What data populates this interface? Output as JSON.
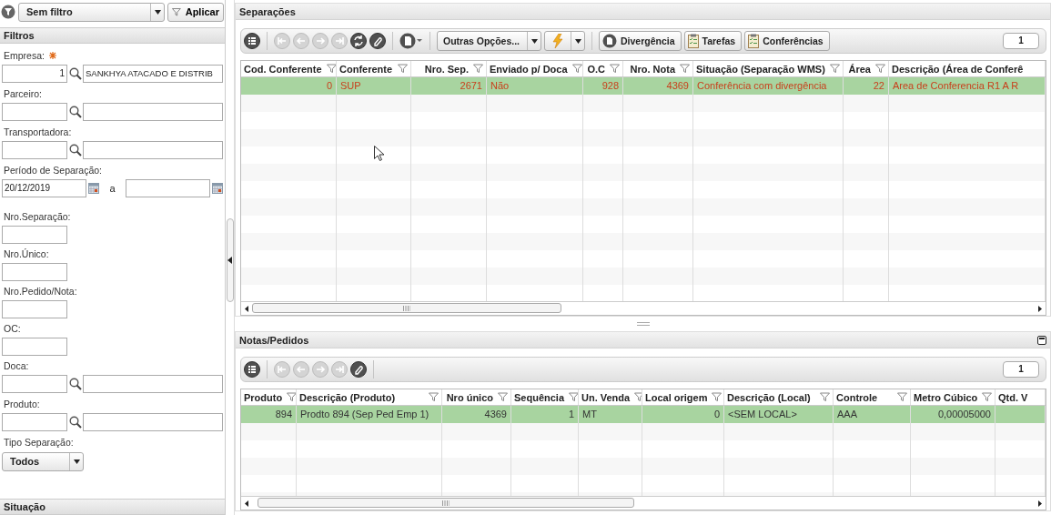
{
  "filter_bar": {
    "preset": "Sem filtro",
    "apply": "Aplicar"
  },
  "filters": {
    "title": "Filtros",
    "fields": [
      {
        "kind": "lookup",
        "label": "Empresa:",
        "required": true,
        "code": "1",
        "description": "SANKHYA ATACADO E DISTRIB"
      },
      {
        "kind": "lookup",
        "label": "Parceiro:",
        "required": false
      },
      {
        "kind": "lookup",
        "label": "Transportadora:",
        "required": false
      },
      {
        "kind": "date-range",
        "label": "Período de Separação:",
        "required": false,
        "from": "20/12/2019",
        "separator": "a"
      },
      {
        "kind": "text",
        "label": "Nro.Separação:",
        "required": false
      },
      {
        "kind": "text",
        "label": "Nro.Único:",
        "required": false
      },
      {
        "kind": "text",
        "label": "Nro.Pedido/Nota:",
        "required": false
      },
      {
        "kind": "text",
        "label": "OC:",
        "required": false
      },
      {
        "kind": "lookup",
        "label": "Doca:",
        "required": false
      },
      {
        "kind": "lookup",
        "label": "Produto:",
        "required": false
      },
      {
        "kind": "select",
        "label": "Tipo Separação:",
        "required": false,
        "value": "Todos"
      }
    ]
  },
  "situacao": {
    "title": "Situação"
  },
  "separacoes": {
    "title": "Separações",
    "page": "1",
    "toolbar": [
      {
        "kind": "grid",
        "disabled": false
      },
      {
        "kind": "separator"
      },
      {
        "kind": "first",
        "disabled": true
      },
      {
        "kind": "prev",
        "disabled": true
      },
      {
        "kind": "next",
        "disabled": true
      },
      {
        "kind": "last",
        "disabled": true
      },
      {
        "kind": "refresh",
        "disabled": false
      },
      {
        "kind": "clip",
        "disabled": false
      },
      {
        "kind": "separator"
      },
      {
        "kind": "export"
      },
      {
        "kind": "separator"
      },
      {
        "kind": "menu",
        "label": "Outras Opções..."
      },
      {
        "kind": "action"
      },
      {
        "kind": "separator"
      },
      {
        "kind": "doc-button",
        "label": "Divergência"
      },
      {
        "kind": "list-button",
        "label": "Tarefas"
      },
      {
        "kind": "list-button",
        "label": "Conferências"
      }
    ],
    "columns": [
      {
        "label": "Cod. Conferente",
        "kind": "number",
        "filter": true
      },
      {
        "label": "Conferente",
        "kind": "text",
        "filter": true
      },
      {
        "label": "Nro. Sep.",
        "kind": "number",
        "filter": true
      },
      {
        "label": "Enviado p/ Doca",
        "kind": "text",
        "filter": true
      },
      {
        "label": "O.C",
        "kind": "number",
        "filter": true
      },
      {
        "label": "Nro. Nota",
        "kind": "number",
        "filter": true
      },
      {
        "label": "Situação (Separação WMS)",
        "kind": "text",
        "filter": true
      },
      {
        "label": "Área",
        "kind": "number",
        "filter": true
      },
      {
        "label": "Descrição (Área de Conferê",
        "kind": "text",
        "filter": false
      }
    ],
    "rows": [
      {
        "selected": true,
        "cells": [
          "0",
          "SUP",
          "2671",
          "Não",
          "928",
          "4369",
          "Conferência com divergência",
          "22",
          "Area de Conferencia R1 A R"
        ]
      }
    ]
  },
  "notas": {
    "title": "Notas/Pedidos",
    "page": "1",
    "toolbar": [
      {
        "kind": "grid",
        "disabled": false
      },
      {
        "kind": "separator"
      },
      {
        "kind": "first",
        "disabled": true
      },
      {
        "kind": "prev",
        "disabled": true
      },
      {
        "kind": "next",
        "disabled": true
      },
      {
        "kind": "last",
        "disabled": true
      },
      {
        "kind": "clip",
        "disabled": false
      },
      {
        "kind": "separator"
      }
    ],
    "columns": [
      {
        "label": "Produto",
        "kind": "number",
        "filter": true
      },
      {
        "label": "Descrição (Produto)",
        "kind": "text",
        "filter": true
      },
      {
        "label": "Nro único",
        "kind": "number",
        "filter": true
      },
      {
        "label": "Sequência",
        "kind": "number",
        "filter": true
      },
      {
        "label": "Un. Venda",
        "kind": "text",
        "filter": true
      },
      {
        "label": "Local origem",
        "kind": "number",
        "filter": true
      },
      {
        "label": "Descrição (Local)",
        "kind": "text",
        "filter": true
      },
      {
        "label": "Controle",
        "kind": "text",
        "filter": true
      },
      {
        "label": "Metro Cúbico",
        "kind": "number",
        "filter": true
      },
      {
        "label": "Qtd. V",
        "kind": "text",
        "filter": false
      }
    ],
    "rows": [
      {
        "selected": true,
        "cells": [
          "894",
          "Prodto 894 (Sep Ped Emp 1)",
          "4369",
          "1",
          "MT",
          "0",
          "<SEM LOCAL>",
          "AAA",
          "0,00005000",
          ""
        ]
      }
    ]
  }
}
